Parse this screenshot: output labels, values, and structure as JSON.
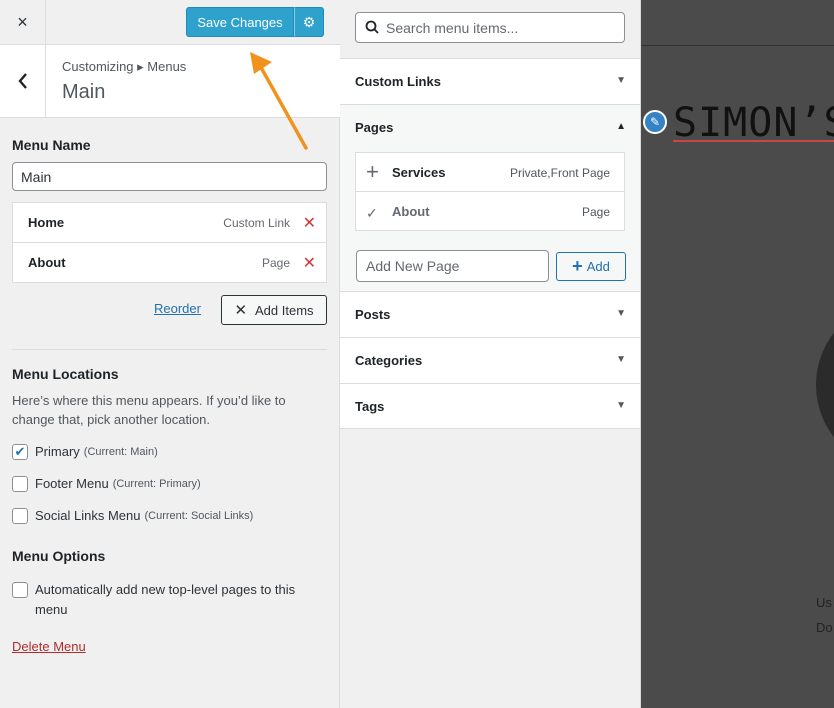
{
  "topbar": {
    "close_icon": "×",
    "save_label": "Save Changes",
    "gear_icon": "⚙"
  },
  "header": {
    "breadcrumb": "Customizing ▸ Menus",
    "title": "Main"
  },
  "menu_name": {
    "label": "Menu Name",
    "value": "Main"
  },
  "menu_items": [
    {
      "title": "Home",
      "type": "Custom Link"
    },
    {
      "title": "About",
      "type": "Page"
    }
  ],
  "actions": {
    "reorder": "Reorder",
    "add_items": "Add Items"
  },
  "locations": {
    "title": "Menu Locations",
    "description": "Here’s where this menu appears. If you’d like to change that, pick another location.",
    "items": [
      {
        "label": "Primary",
        "current": "(Current: Main)",
        "checked": true
      },
      {
        "label": "Footer Menu",
        "current": "(Current: Primary)",
        "checked": false
      },
      {
        "label": "Social Links Menu",
        "current": "(Current: Social Links)",
        "checked": false
      }
    ]
  },
  "options": {
    "title": "Menu Options",
    "auto_add": "Automatically add new top-level pages to this menu"
  },
  "delete_menu": "Delete Menu",
  "search": {
    "placeholder": "Search menu items..."
  },
  "sections": {
    "custom_links": "Custom Links",
    "pages": "Pages",
    "posts": "Posts",
    "categories": "Categories",
    "tags": "Tags"
  },
  "pages_list": [
    {
      "name": "Services",
      "type": "Private,Front Page",
      "icon": "+"
    },
    {
      "name": "About",
      "type": "Page",
      "icon": "✓"
    }
  ],
  "new_page": {
    "placeholder": "Add New Page",
    "button": "Add"
  },
  "preview": {
    "site_title": "SIMON’S",
    "text": "Us am ali Do"
  },
  "colors": {
    "accent": "#2ea2cc",
    "arrow": "#f0921c",
    "danger": "#d63638"
  }
}
